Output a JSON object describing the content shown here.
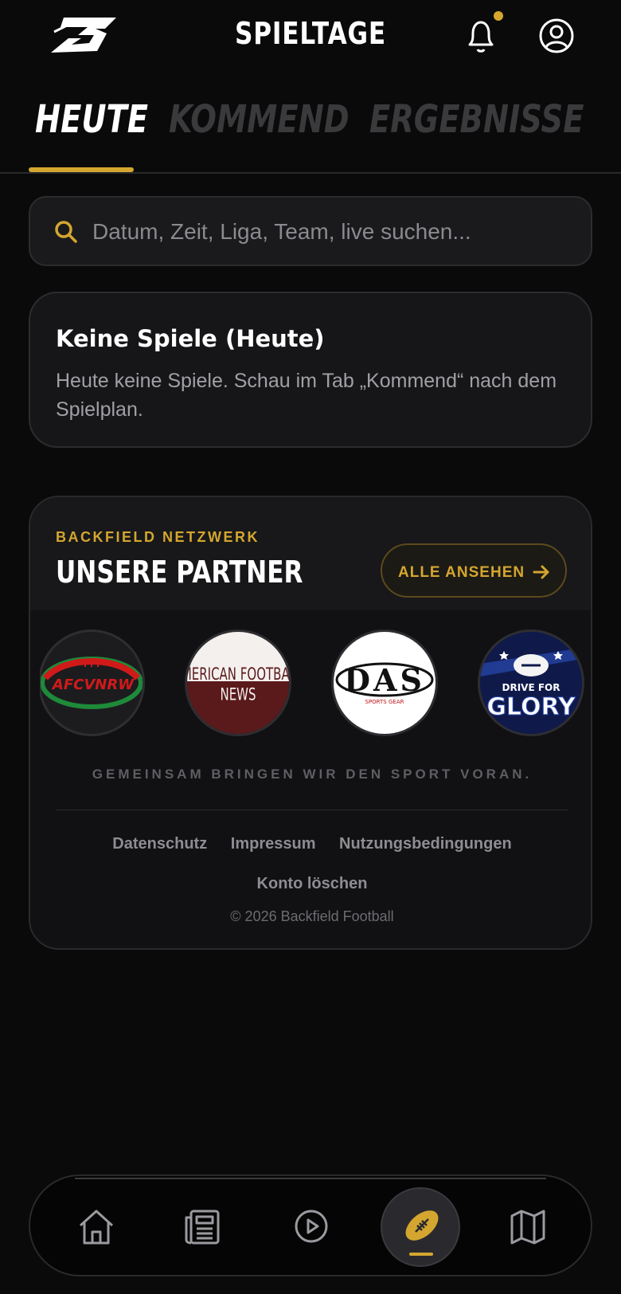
{
  "header": {
    "title": "SPIELTAGE",
    "logo_icon": "backfield-b-logo",
    "notification_icon": "bell-icon",
    "has_unread_notifications": true,
    "profile_icon": "user-circle-icon"
  },
  "tabs": [
    {
      "label": "HEUTE",
      "active": true
    },
    {
      "label": "KOMMEND",
      "active": false
    },
    {
      "label": "ERGEBNISSE",
      "active": false
    }
  ],
  "search": {
    "placeholder": "Datum, Zeit, Liga, Team, live suchen...",
    "value": ""
  },
  "empty_state": {
    "title": "Keine Spiele (Heute)",
    "text": "Heute keine Spiele. Schau im Tab „Kommend“ nach dem Spielplan."
  },
  "partners": {
    "eyebrow": "BACKFIELD NETZWERK",
    "title": "UNSERE PARTNER",
    "see_all_label": "ALLE ANSEHEN",
    "logos": [
      {
        "text": "AFCVNRW"
      },
      {
        "line1": "AMERICAN FOOTBALL",
        "line2": "NEWS"
      },
      {
        "text": "DAS",
        "sub": "SPORTS GEAR"
      },
      {
        "line1": "DRIVE FOR",
        "line2": "GLORY"
      }
    ],
    "tagline": "GEMEINSAM BRINGEN WIR DEN SPORT VORAN."
  },
  "footer": {
    "links": [
      "Datenschutz",
      "Impressum",
      "Nutzungsbedingungen"
    ],
    "delete_account": "Konto löschen",
    "copyright": "© 2026 Backfield Football"
  },
  "nav": {
    "items": [
      "home-icon",
      "news-icon",
      "play-icon",
      "football-icon",
      "map-icon"
    ],
    "active": "football-icon"
  },
  "colors": {
    "accent": "#d4a630",
    "background": "#0a0a0a",
    "card": "#161618"
  }
}
